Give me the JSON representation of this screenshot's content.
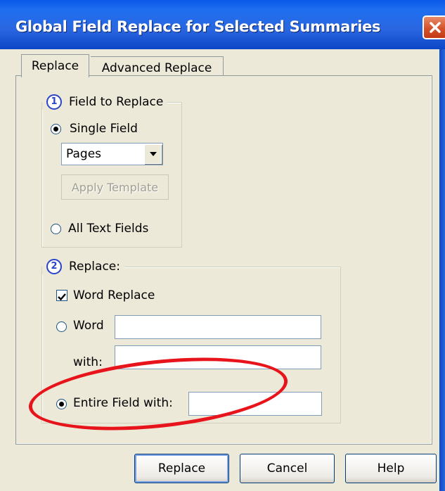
{
  "dialog": {
    "title": "Global Field Replace for Selected Summaries",
    "tabs": [
      {
        "label": "Replace",
        "active": true
      },
      {
        "label": "Advanced Replace",
        "active": false
      }
    ]
  },
  "field_section": {
    "number": "1",
    "legend": "Field to Replace",
    "single_field_label": "Single Field",
    "single_field_selected": true,
    "field_select_value": "Pages",
    "apply_template_label": "Apply Template",
    "all_text_fields_label": "All Text Fields",
    "all_text_fields_selected": false
  },
  "replace_section": {
    "number": "2",
    "legend": "Replace:",
    "word_replace_label": "Word Replace",
    "word_replace_checked": true,
    "word_label": "Word",
    "word_value": "",
    "with_label": "with:",
    "with_value": "",
    "entire_field_label": "Entire Field with:",
    "entire_field_selected": true,
    "entire_field_value": ""
  },
  "buttons": {
    "replace": "Replace",
    "cancel": "Cancel",
    "help": "Help"
  },
  "colors": {
    "titlebar": "#2a66e0",
    "annotation": "#e8141b",
    "window_bg": "#ece9d8"
  }
}
